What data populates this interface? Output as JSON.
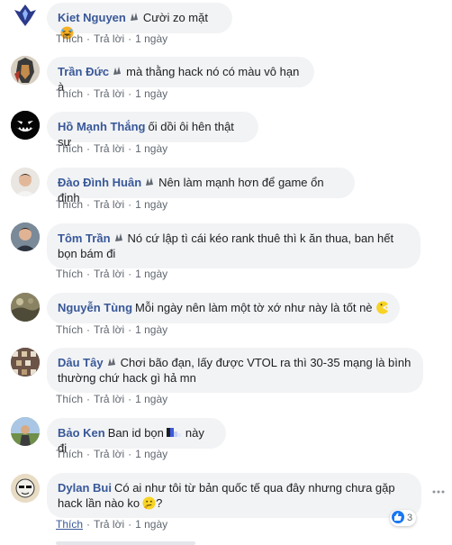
{
  "comments": [
    {
      "author": "Kiet Nguyen",
      "text": "Cười zo mặt",
      "actions": {
        "like": "Thích",
        "reply": "Trả lời",
        "time": "1 ngày"
      }
    },
    {
      "author": "Trần Đức",
      "text": "mà thằng hack nó có màu vô hạn à",
      "actions": {
        "like": "Thích",
        "reply": "Trả lời",
        "time": "1 ngày"
      }
    },
    {
      "author": "Hồ Mạnh Thắng",
      "text": "ối dồi ôi hên thật sự",
      "actions": {
        "like": "Thích",
        "reply": "Trả lời",
        "time": "1 ngày"
      }
    },
    {
      "author": "Đào Đình Huân",
      "text": "Nên làm mạnh hơn để game ổn định",
      "actions": {
        "like": "Thích",
        "reply": "Trả lời",
        "time": "1 ngày"
      }
    },
    {
      "author": "Tôm Trần",
      "text_line1": "Nó cứ lập tì cái kéo rank thuê thì k ăn thua, ban hết",
      "text_line2": "bọn bám đi",
      "actions": {
        "like": "Thích",
        "reply": "Trả lời",
        "time": "1 ngày"
      }
    },
    {
      "author": "Nguyễn Tùng",
      "text": "Mỗi ngày nên làm một tờ xớ như này là tốt nè",
      "actions": {
        "like": "Thích",
        "reply": "Trả lời",
        "time": "1 ngày"
      }
    },
    {
      "author": "Dâu Tây",
      "text_line1": "Chơi bão đạn, lấy được VTOL ra thì 30-35 mạng là bình",
      "text_line2": "thường chứ hack gì hả mn",
      "actions": {
        "like": "Thích",
        "reply": "Trả lời",
        "time": "1 ngày"
      }
    },
    {
      "author": "Bảo Ken",
      "text_before": "Ban id bọn",
      "text_after": "này đi",
      "actions": {
        "like": "Thích",
        "reply": "Trả lời",
        "time": "1 ngày"
      }
    },
    {
      "author": "Dylan Bui",
      "text_line1": "Có ai như tôi từ bản quốc tế qua đây nhưng chưa gặp",
      "text_line2": "hack lần nào ko",
      "text_line2_end": "?",
      "actions": {
        "like": "Thích",
        "reply": "Trả lời",
        "time": "1 ngày"
      },
      "reactions": "3"
    }
  ],
  "colors": {
    "author": "#385898",
    "bubble": "#f2f3f5",
    "meta": "#606770",
    "like_reaction": "#1877f2"
  }
}
